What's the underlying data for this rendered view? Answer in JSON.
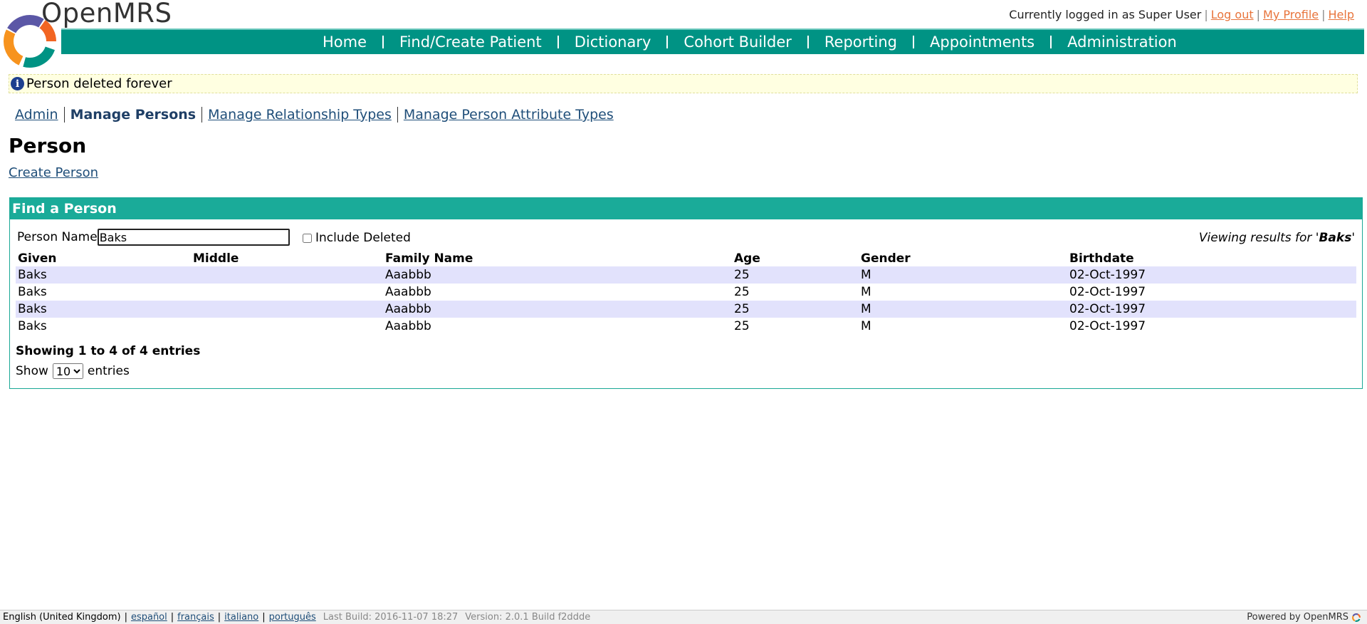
{
  "header": {
    "brand": "OpenMRS",
    "logged_in_text": "Currently logged in as Super User",
    "logout": "Log out",
    "my_profile": "My Profile",
    "help": "Help"
  },
  "nav": {
    "items": [
      "Home",
      "Find/Create Patient",
      "Dictionary",
      "Cohort Builder",
      "Reporting",
      "Appointments",
      "Administration"
    ]
  },
  "info": {
    "message": "Person deleted forever",
    "icon": "info-icon"
  },
  "admin_nav": {
    "admin": "Admin",
    "manage_persons": "Manage Persons",
    "manage_relationship_types": "Manage Relationship Types",
    "manage_person_attribute_types": "Manage Person Attribute Types"
  },
  "page": {
    "title": "Person",
    "create_person": "Create Person"
  },
  "find": {
    "header": "Find a Person",
    "person_name_label": "Person Name",
    "person_name_value": "Baks",
    "include_deleted_label": "Include Deleted",
    "viewing_prefix": "Viewing results for '",
    "viewing_term": "Baks",
    "viewing_suffix": "'"
  },
  "table": {
    "columns": [
      "Given",
      "Middle",
      "Family Name",
      "Age",
      "Gender",
      "Birthdate"
    ],
    "rows": [
      [
        "Baks",
        "",
        "Aaabbb",
        "25",
        "M",
        "02-Oct-1997"
      ],
      [
        "Baks",
        "",
        "Aaabbb",
        "25",
        "M",
        "02-Oct-1997"
      ],
      [
        "Baks",
        "",
        "Aaabbb",
        "25",
        "M",
        "02-Oct-1997"
      ],
      [
        "Baks",
        "",
        "Aaabbb",
        "25",
        "M",
        "02-Oct-1997"
      ]
    ],
    "showing": "Showing 1 to 4 of 4 entries",
    "show_label": "Show",
    "show_value": "10",
    "entries_label": "entries"
  },
  "footer": {
    "languages": [
      "English (United Kingdom)",
      "español",
      "français",
      "italiano",
      "português"
    ],
    "last_build": "Last Build: 2016-11-07 18:27",
    "version": "Version: 2.0.1 Build f2ddde",
    "powered_by": "Powered by OpenMRS"
  },
  "colors": {
    "nav": "#009384",
    "accent": "#1aab99",
    "link": "#1f4e79",
    "header_link": "#e8743b",
    "row_stripe": "#e2e2fc"
  }
}
